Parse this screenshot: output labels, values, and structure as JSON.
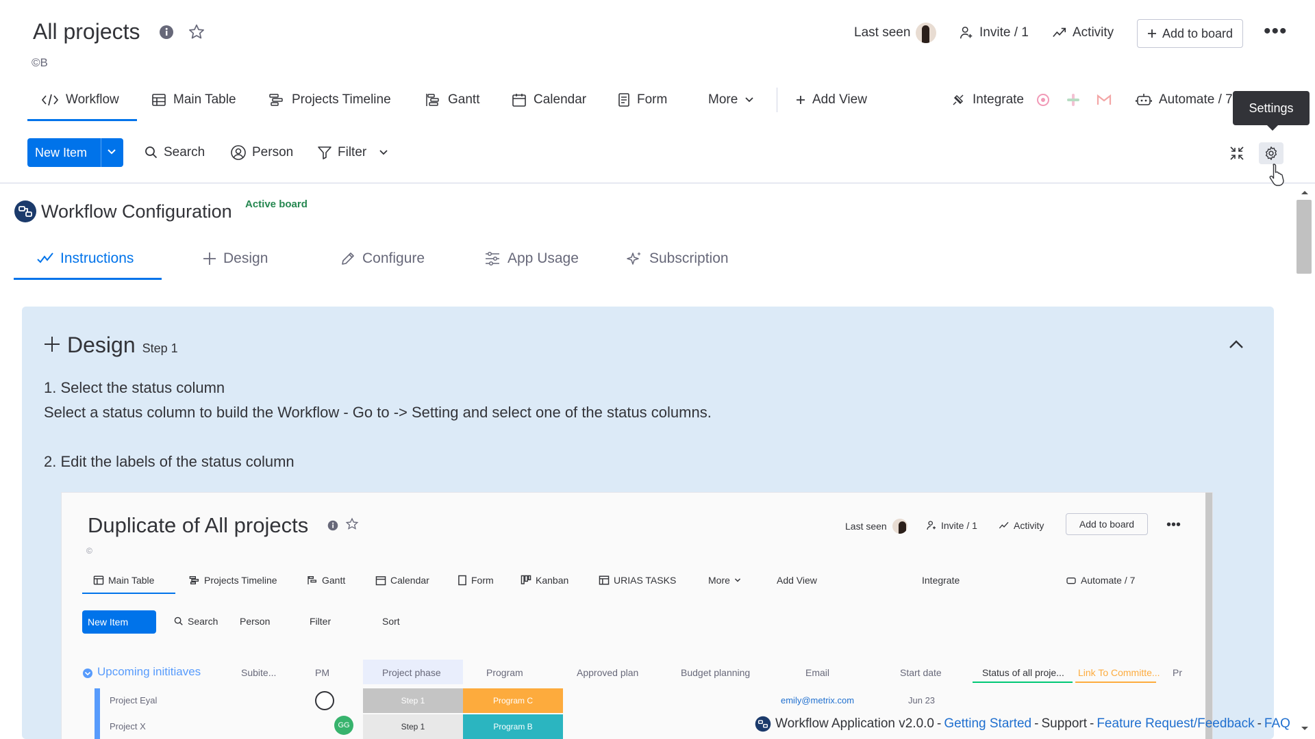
{
  "board": {
    "title": "All projects",
    "owner": "©B",
    "last_seen_label": "Last seen",
    "invite_label": "Invite / 1",
    "activity_label": "Activity",
    "add_to_board_label": "Add to board",
    "more_menu": "•••"
  },
  "views": {
    "tabs": [
      {
        "label": "Workflow",
        "icon": "code-icon",
        "active": true
      },
      {
        "label": "Main Table",
        "icon": "table-icon"
      },
      {
        "label": "Projects Timeline",
        "icon": "timeline-icon"
      },
      {
        "label": "Gantt",
        "icon": "gantt-icon"
      },
      {
        "label": "Calendar",
        "icon": "calendar-icon"
      },
      {
        "label": "Form",
        "icon": "form-icon"
      },
      {
        "label": "More",
        "icon": "chevron-down-icon"
      }
    ],
    "add_view_label": "Add View",
    "integrate_label": "Integrate",
    "automate_label": "Automate / 7"
  },
  "toolbar": {
    "new_item_label": "New Item",
    "search_label": "Search",
    "person_label": "Person",
    "filter_label": "Filter",
    "settings_tooltip": "Settings"
  },
  "app": {
    "title": "Workflow Configuration",
    "status_badge": "Active board",
    "tabs": [
      {
        "label": "Instructions",
        "icon": "check-icon",
        "active": true
      },
      {
        "label": "Design",
        "icon": "plus-icon"
      },
      {
        "label": "Configure",
        "icon": "pencil-icon"
      },
      {
        "label": "App Usage",
        "icon": "sliders-icon"
      },
      {
        "label": "Subscription",
        "icon": "sparkle-icon"
      }
    ]
  },
  "design_section": {
    "title": "Design",
    "step": "Step 1",
    "item1_title": "1. Select the status column",
    "item1_body": "Select a status column to build the Workflow - Go to -> Setting and select one of the status columns.",
    "item2_title": "2. Edit the labels of the status column"
  },
  "embedded": {
    "title": "Duplicate of All projects",
    "owner": "©",
    "last_seen_label": "Last seen",
    "invite_label": "Invite / 1",
    "activity_label": "Activity",
    "add_to_board_label": "Add to board",
    "tabs": [
      "Main Table",
      "Projects Timeline",
      "Gantt",
      "Calendar",
      "Form",
      "Kanban",
      "URIAS TASKS",
      "More"
    ],
    "add_view_label": "Add View",
    "integrate_label": "Integrate",
    "automate_label": "Automate / 7",
    "new_item_label": "New Item",
    "toolbar": [
      "Search",
      "Person",
      "Filter",
      "Sort"
    ],
    "group_title": "Upcoming inititiaves",
    "columns": [
      "Subite...",
      "PM",
      "Project phase",
      "Program",
      "Approved plan",
      "Budget planning",
      "Email",
      "Start date",
      "Status of all proje...",
      "Link To Committe...",
      "Pr"
    ],
    "rows": [
      {
        "name": "Project Eyal",
        "phase": "Step 1",
        "program": "Program C",
        "email": "emily@metrix.com",
        "start": "Jun 23"
      },
      {
        "name": "Project X",
        "phase": "Step 1",
        "program": "Program B",
        "pm_initials": "GG"
      }
    ]
  },
  "footer": {
    "app_name": "Workflow Application v2.0.0",
    "links": [
      "Getting Started",
      "Support",
      "Feature Request/Feedback",
      "FAQ"
    ]
  },
  "colors": {
    "primary": "#0073ea",
    "active_badge": "#258750",
    "card_bg": "#dceaf7",
    "program_c": "#fdab3d",
    "program_b": "#2bb5c0"
  }
}
